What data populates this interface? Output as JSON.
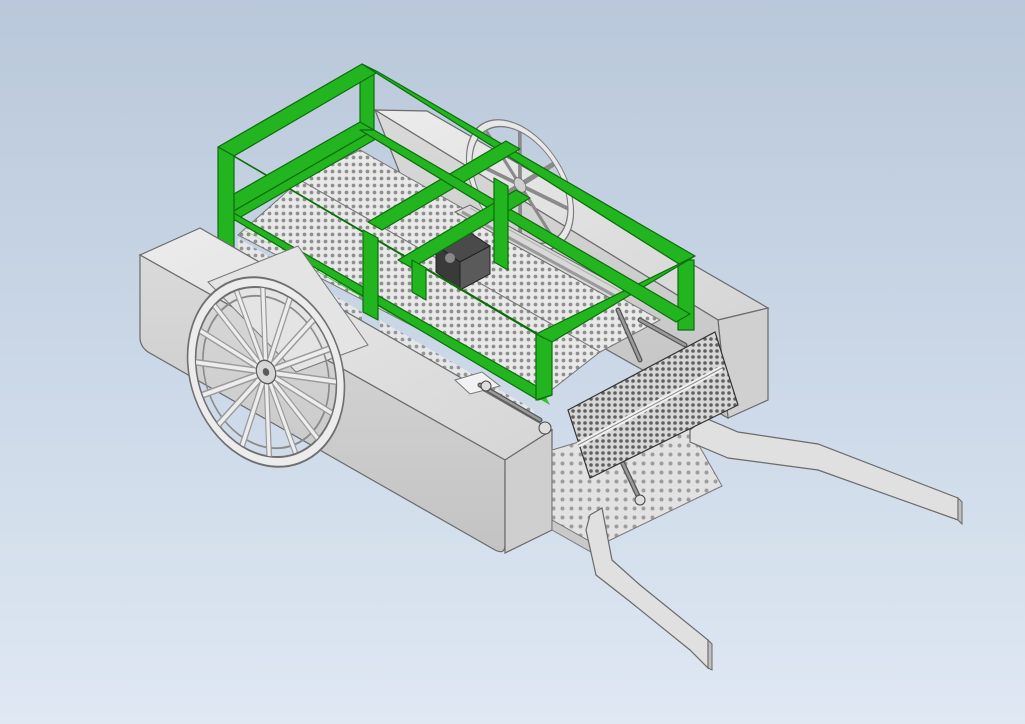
{
  "viewport": {
    "background_top": "#b9c8da",
    "background_bottom": "#dfe8f3"
  },
  "model": {
    "frame_color": "#22b51f",
    "frame_edge_color": "#0d6e0c",
    "body_color": "#dcdcdc",
    "body_edge_color": "#6a6a6a",
    "mesh_color": "#9a9a9a",
    "wheel_color": "#e6e6e6",
    "components": [
      "frame",
      "left-pontoon",
      "right-pontoon",
      "front-wheel",
      "rear-wheel",
      "motor",
      "linear-actuator",
      "mesh-basket",
      "scoop-plate",
      "rake",
      "intake-arm-left",
      "intake-arm-right"
    ]
  }
}
